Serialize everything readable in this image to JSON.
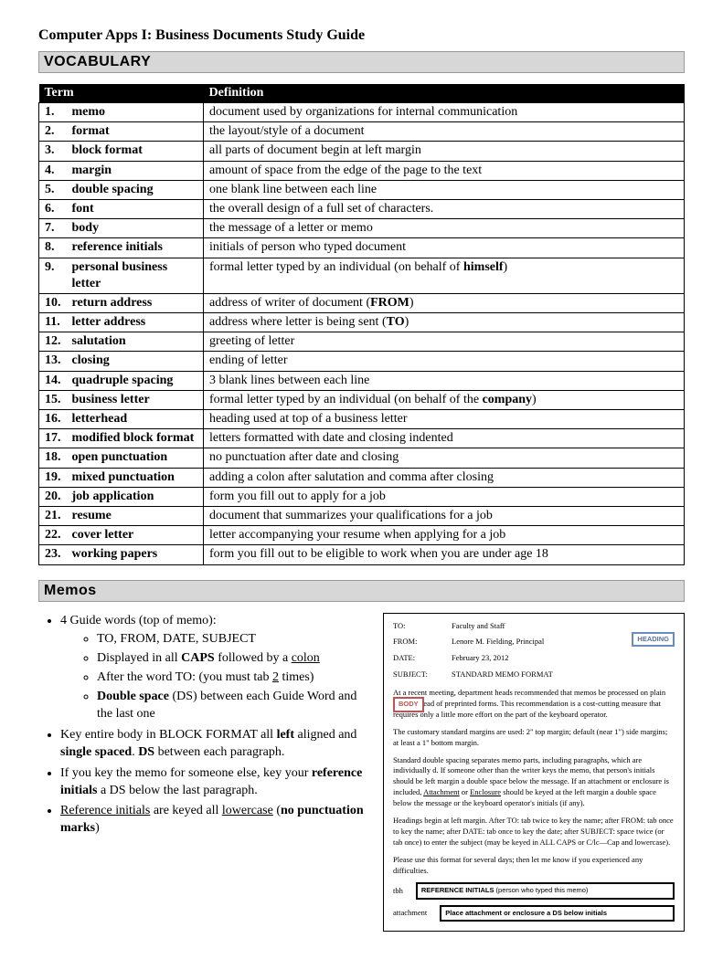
{
  "title": "Computer Apps I:  Business Documents Study Guide",
  "sections": {
    "vocab_header": "VOCABULARY",
    "memos_header": "Memos"
  },
  "vocab_table": {
    "headers": {
      "term": "Term",
      "definition": "Definition"
    },
    "rows": [
      {
        "n": "1.",
        "term": "memo",
        "def": "document used by organizations for internal communication"
      },
      {
        "n": "2.",
        "term": "format",
        "def": "the layout/style of a document"
      },
      {
        "n": "3.",
        "term": "block format",
        "def": "all parts of document begin at left margin"
      },
      {
        "n": "4.",
        "term": "margin",
        "def": "amount of space from the edge of the page to the text"
      },
      {
        "n": "5.",
        "term": "double spacing",
        "def": "one blank line between each line"
      },
      {
        "n": "6.",
        "term": "font",
        "def": "the overall design of a full set of characters."
      },
      {
        "n": "7.",
        "term": "body",
        "def": "the message of a letter or memo"
      },
      {
        "n": "8.",
        "term": "reference initials",
        "def": "initials of person who typed document"
      },
      {
        "n": "9.",
        "term": "personal business letter",
        "def_pre": "formal letter typed by an individual (on behalf of ",
        "def_bold": "himself",
        "def_post": ")"
      },
      {
        "n": "10.",
        "term": "return address",
        "def_pre": "address of writer of document (",
        "def_bold": "FROM",
        "def_post": ")"
      },
      {
        "n": "11.",
        "term": "letter address",
        "def_pre": "address where letter is being sent (",
        "def_bold": "TO",
        "def_post": ")"
      },
      {
        "n": "12.",
        "term": "salutation",
        "def": "greeting of letter"
      },
      {
        "n": "13.",
        "term": "closing",
        "def": "ending of letter"
      },
      {
        "n": "14.",
        "term": "quadruple spacing",
        "def": "3 blank lines between each line"
      },
      {
        "n": "15.",
        "term": "business letter",
        "def_pre": "formal letter typed by an individual (on behalf of the ",
        "def_bold": "company",
        "def_post": ")"
      },
      {
        "n": "16.",
        "term": "letterhead",
        "def": "heading used at top of a business letter"
      },
      {
        "n": "17.",
        "term": "modified block format",
        "def": "letters formatted with date and closing indented"
      },
      {
        "n": "18.",
        "term": "open punctuation",
        "def": "no punctuation after date and closing"
      },
      {
        "n": "19.",
        "term": "mixed punctuation",
        "def": "adding a colon after salutation and comma after closing"
      },
      {
        "n": "20.",
        "term": "job application",
        "def": "form you fill out to apply for a job"
      },
      {
        "n": "21.",
        "term": "resume",
        "def": "document that summarizes your qualifications for a job"
      },
      {
        "n": "22.",
        "term": "cover letter",
        "def": "letter accompanying your resume when applying for a job"
      },
      {
        "n": "23.",
        "term": "working papers",
        "def": "form you fill out to be eligible to work when you are under age 18"
      }
    ]
  },
  "memo_bullets": {
    "b1": "4 Guide words (top of memo):",
    "b1a": "TO, FROM, DATE, SUBJECT",
    "b1b_pre": "Displayed in all ",
    "b1b_bold": "CAPS",
    "b1b_mid": " followed by a ",
    "b1b_u": "colon",
    "b1c_pre": "After the word TO:  (you must tab ",
    "b1c_u": "2",
    "b1c_post": " times)",
    "b1d_bold": "Double space",
    "b1d_post": " (DS) between each Guide Word and the last one",
    "b2_pre": "Key entire body in BLOCK FORMAT all ",
    "b2_bold1": "left",
    "b2_mid": " aligned and ",
    "b2_bold2": "single spaced",
    "b2_post1": ".  ",
    "b2_bold3": "DS",
    "b2_post2": " between each paragraph.",
    "b3_pre": "If you key the memo for someone else, key your ",
    "b3_bold": "reference initials",
    "b3_post": " a DS below the last paragraph.",
    "b4_u": "Reference initials",
    "b4_mid": " are keyed all ",
    "b4_u2": "lowercase",
    "b4_post": " (",
    "b4_bold": "no punctuation marks",
    "b4_close": ")"
  },
  "memo_sample": {
    "heading_label": "HEADING",
    "body_label": "BODY",
    "to_label": "TO:",
    "to_val": "Faculty and Staff",
    "from_label": "FROM:",
    "from_val": "Lenore M. Fielding, Principal",
    "date_label": "DATE:",
    "date_val": "February 23, 2012",
    "subject_label": "SUBJECT:",
    "subject_val": "STANDARD MEMO FORMAT",
    "p1": "At a recent meeting, department heads recommended that memos be processed on plain paper instead of preprinted forms. This recommendation is a cost-cutting measure that requires only a little more effort on the part of the keyboard operator.",
    "p2": "The customary standard margins are used: 2\" top margin; default (near 1\") side margins; at least a 1\" bottom margin.",
    "p3_pre": "Standard double spacing separates memo parts, including paragraphs, which are individually ",
    "p3_mid": "d. If someone other than the writer keys the memo, that person's initials should be left margin a double space below the message. If an attachment or enclosure is included, ",
    "p3_u1": "Attachment",
    "p3_or": " or ",
    "p3_u2": "Enclosure",
    "p3_post": " should be keyed at the left margin a double space below the message or the keyboard operator's initials (if any).",
    "p4": "Headings begin at left margin. After TO: tab twice to key the name; after FROM: tab once to key the name; after DATE: tab once to key the date; after SUBJECT: space twice (or tab once) to enter the subject (may be keyed in ALL CAPS or C/lc—Cap and lowercase).",
    "p5": "Please use this format for several days; then let me know if you experienced any difficulties.",
    "ref_initials": "tbh",
    "ref_box1_bold": "REFERENCE INITIALS",
    "ref_box1_post": " (person who typed this memo)",
    "attach_label": "attachment",
    "ref_box2": "Place attachment or enclosure a DS below initials"
  }
}
